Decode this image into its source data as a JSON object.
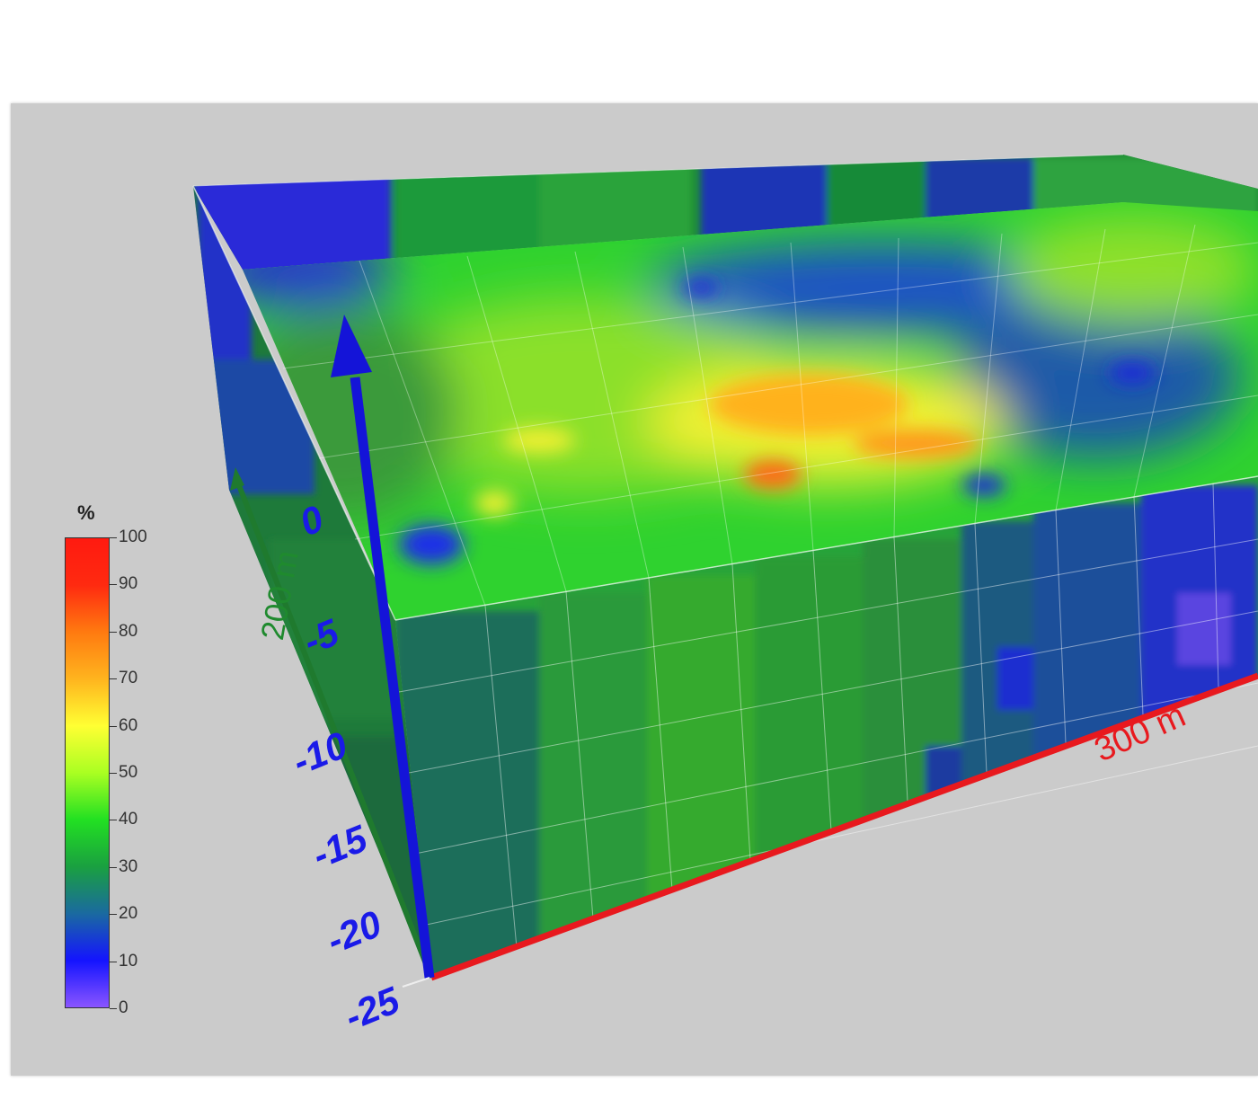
{
  "chart_data": {
    "type": "heatmap",
    "subtype": "3d-volume",
    "colorbar": {
      "unit": "%",
      "min": 0,
      "max": 100,
      "ticks": [
        "100",
        "90",
        "80",
        "70",
        "60",
        "50",
        "40",
        "30",
        "20",
        "10",
        "0"
      ],
      "colors": [
        "#8a55ff",
        "#1414ff",
        "#1a6aa0",
        "#1aa040",
        "#22e022",
        "#aaff22",
        "#ffff33",
        "#ffb41e",
        "#ff7a10",
        "#ff2a10",
        "#ff1a10"
      ]
    },
    "z_axis": {
      "ticks": [
        "0",
        "-5",
        "-10",
        "-15",
        "-20",
        "-25"
      ],
      "color": "#1a1ae8"
    },
    "y_axis": {
      "label": "200 m",
      "color": "#1f8a2e"
    },
    "x_axis": {
      "label": "300 m",
      "color": "#e8191e"
    },
    "surface_anomalies": [
      {
        "level": "high",
        "value": 70
      },
      {
        "level": "high",
        "value": 75
      },
      {
        "level": "low",
        "value": 15
      },
      {
        "level": "low",
        "value": 20
      }
    ]
  }
}
